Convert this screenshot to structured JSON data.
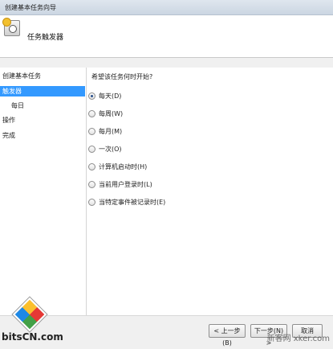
{
  "window": {
    "title": "创建基本任务向导"
  },
  "header": {
    "title": "任务触发器",
    "icon": "task-scheduler-icon"
  },
  "nav": {
    "items": [
      {
        "label": "创建基本任务",
        "selected": false,
        "sub": false
      },
      {
        "label": "触发器",
        "selected": true,
        "sub": false
      },
      {
        "label": "每日",
        "selected": false,
        "sub": true
      },
      {
        "label": "操作",
        "selected": false,
        "sub": false
      },
      {
        "label": "完成",
        "selected": false,
        "sub": false
      }
    ]
  },
  "content": {
    "question": "希望该任务何时开始?",
    "options": [
      {
        "label": "每天(D)",
        "checked": true
      },
      {
        "label": "每周(W)",
        "checked": false
      },
      {
        "label": "每月(M)",
        "checked": false
      },
      {
        "label": "一次(O)",
        "checked": false
      },
      {
        "label": "计算机启动时(H)",
        "checked": false
      },
      {
        "label": "当前用户登录时(L)",
        "checked": false
      },
      {
        "label": "当特定事件被记录时(E)",
        "checked": false
      }
    ]
  },
  "buttons": {
    "back": "< 上一步(B)",
    "next": "下一步(N) >",
    "cancel": "取消"
  },
  "branding": {
    "logo_text": "bitsCN.com",
    "watermark": "新客网 xker.com"
  },
  "colors": {
    "selection": "#3399ff"
  }
}
